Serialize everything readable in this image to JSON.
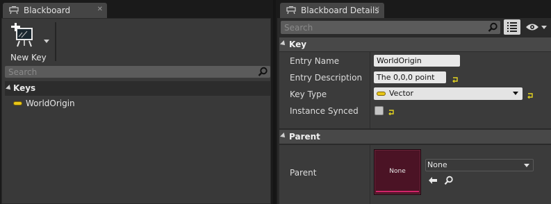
{
  "left_panel": {
    "tab_title": "Blackboard",
    "toolbar": {
      "new_key_label": "New Key"
    },
    "search": {
      "placeholder": "Search"
    },
    "keys_header": "Keys",
    "keys": [
      {
        "name": "WorldOrigin",
        "type_color": "#e9c718"
      }
    ]
  },
  "right_panel": {
    "tab_title": "Blackboard Details",
    "search": {
      "placeholder": "Search"
    },
    "sections": {
      "key": {
        "title": "Key",
        "entry_name": {
          "label": "Entry Name",
          "value": "WorldOrigin"
        },
        "entry_description": {
          "label": "Entry Description",
          "value": "The 0,0,0 point"
        },
        "key_type": {
          "label": "Key Type",
          "value": "Vector"
        },
        "instance_synced": {
          "label": "Instance Synced",
          "checked": false
        }
      },
      "parent": {
        "title": "Parent",
        "label": "Parent",
        "thumbnail_text": "None",
        "asset_value": "None"
      }
    }
  },
  "icons": {
    "tab_icon": "blackboard-tab-icon",
    "new_key": "new-key-icon",
    "search": "search-icon",
    "list_view": "list-view-icon",
    "visibility": "eye-icon",
    "reset": "reset-to-default-icon",
    "browse": "use-selected-arrow-icon",
    "find": "browse-magnifier-icon"
  },
  "colors": {
    "vector_pin": "#e9c718",
    "reset_arrow": "#e5d520",
    "thumbnail_bg": "#4b1325",
    "thumbnail_bar": "#d2246a"
  }
}
